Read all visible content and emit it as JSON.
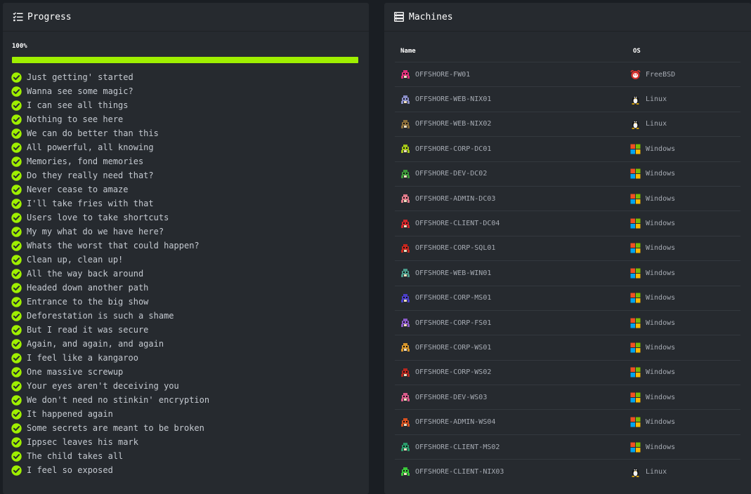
{
  "progress": {
    "title": "Progress",
    "icon": "checklist-icon",
    "percent_label": "100%",
    "percent": 100,
    "accent": "#9fef00",
    "flags": [
      "Just getting' started",
      "Wanna see some magic?",
      "I can see all things",
      "Nothing to see here",
      "We can do better than this",
      "All powerful, all knowing",
      "Memories, fond memories",
      "Do they really need that?",
      "Never cease to amaze",
      "I'll take fries with that",
      "Users love to take shortcuts",
      "My my what do we have here?",
      "Whats the worst that could happen?",
      "Clean up, clean up!",
      "All the way back around",
      "Headed down another path",
      "Entrance to the big show",
      "Deforestation is such a shame",
      "But I read it was secure",
      "Again, and again, and again",
      "I feel like a kangaroo",
      "One massive screwup",
      "Your eyes aren't deceiving you",
      "We don't need no stinkin' encryption",
      "It happened again",
      "Some secrets are meant to be broken",
      "Ippsec leaves his mark",
      "The child takes all",
      "I feel so exposed"
    ]
  },
  "machines": {
    "title": "Machines",
    "icon": "server-icon",
    "columns": {
      "name": "Name",
      "os": "OS"
    },
    "rows": [
      {
        "name": "OFFSHORE-FW01",
        "os": "FreeBSD",
        "os_icon": "freebsd-icon",
        "avatar_color": "#e0307a"
      },
      {
        "name": "OFFSHORE-WEB-NIX01",
        "os": "Linux",
        "os_icon": "linux-icon",
        "avatar_color": "#8a8ec8"
      },
      {
        "name": "OFFSHORE-WEB-NIX02",
        "os": "Linux",
        "os_icon": "linux-icon",
        "avatar_color": "#8c6f3a"
      },
      {
        "name": "OFFSHORE-CORP-DC01",
        "os": "Windows",
        "os_icon": "windows-icon",
        "avatar_color": "#a4c619"
      },
      {
        "name": "OFFSHORE-DEV-DC02",
        "os": "Windows",
        "os_icon": "windows-icon",
        "avatar_color": "#3d9a3a"
      },
      {
        "name": "OFFSHORE-ADMIN-DC03",
        "os": "Windows",
        "os_icon": "windows-icon",
        "avatar_color": "#e07a8a"
      },
      {
        "name": "OFFSHORE-CLIENT-DC04",
        "os": "Windows",
        "os_icon": "windows-icon",
        "avatar_color": "#d2262a"
      },
      {
        "name": "OFFSHORE-CORP-SQL01",
        "os": "Windows",
        "os_icon": "windows-icon",
        "avatar_color": "#c8261e"
      },
      {
        "name": "OFFSHORE-WEB-WIN01",
        "os": "Windows",
        "os_icon": "windows-icon",
        "avatar_color": "#4a9a8a"
      },
      {
        "name": "OFFSHORE-CORP-MS01",
        "os": "Windows",
        "os_icon": "windows-icon",
        "avatar_color": "#4a3ec8"
      },
      {
        "name": "OFFSHORE-CORP-FS01",
        "os": "Windows",
        "os_icon": "windows-icon",
        "avatar_color": "#8a5ac8"
      },
      {
        "name": "OFFSHORE-CORP-WS01",
        "os": "Windows",
        "os_icon": "windows-icon",
        "avatar_color": "#d8962a"
      },
      {
        "name": "OFFSHORE-CORP-WS02",
        "os": "Windows",
        "os_icon": "windows-icon",
        "avatar_color": "#b8261e"
      },
      {
        "name": "OFFSHORE-DEV-WS03",
        "os": "Windows",
        "os_icon": "windows-icon",
        "avatar_color": "#d85a8a"
      },
      {
        "name": "OFFSHORE-ADMIN-WS04",
        "os": "Windows",
        "os_icon": "windows-icon",
        "avatar_color": "#d8501e"
      },
      {
        "name": "OFFSHORE-CLIENT-MS02",
        "os": "Windows",
        "os_icon": "windows-icon",
        "avatar_color": "#2a9a6a"
      },
      {
        "name": "OFFSHORE-CLIENT-NIX03",
        "os": "Linux",
        "os_icon": "linux-icon",
        "avatar_color": "#3ac83a"
      }
    ]
  }
}
